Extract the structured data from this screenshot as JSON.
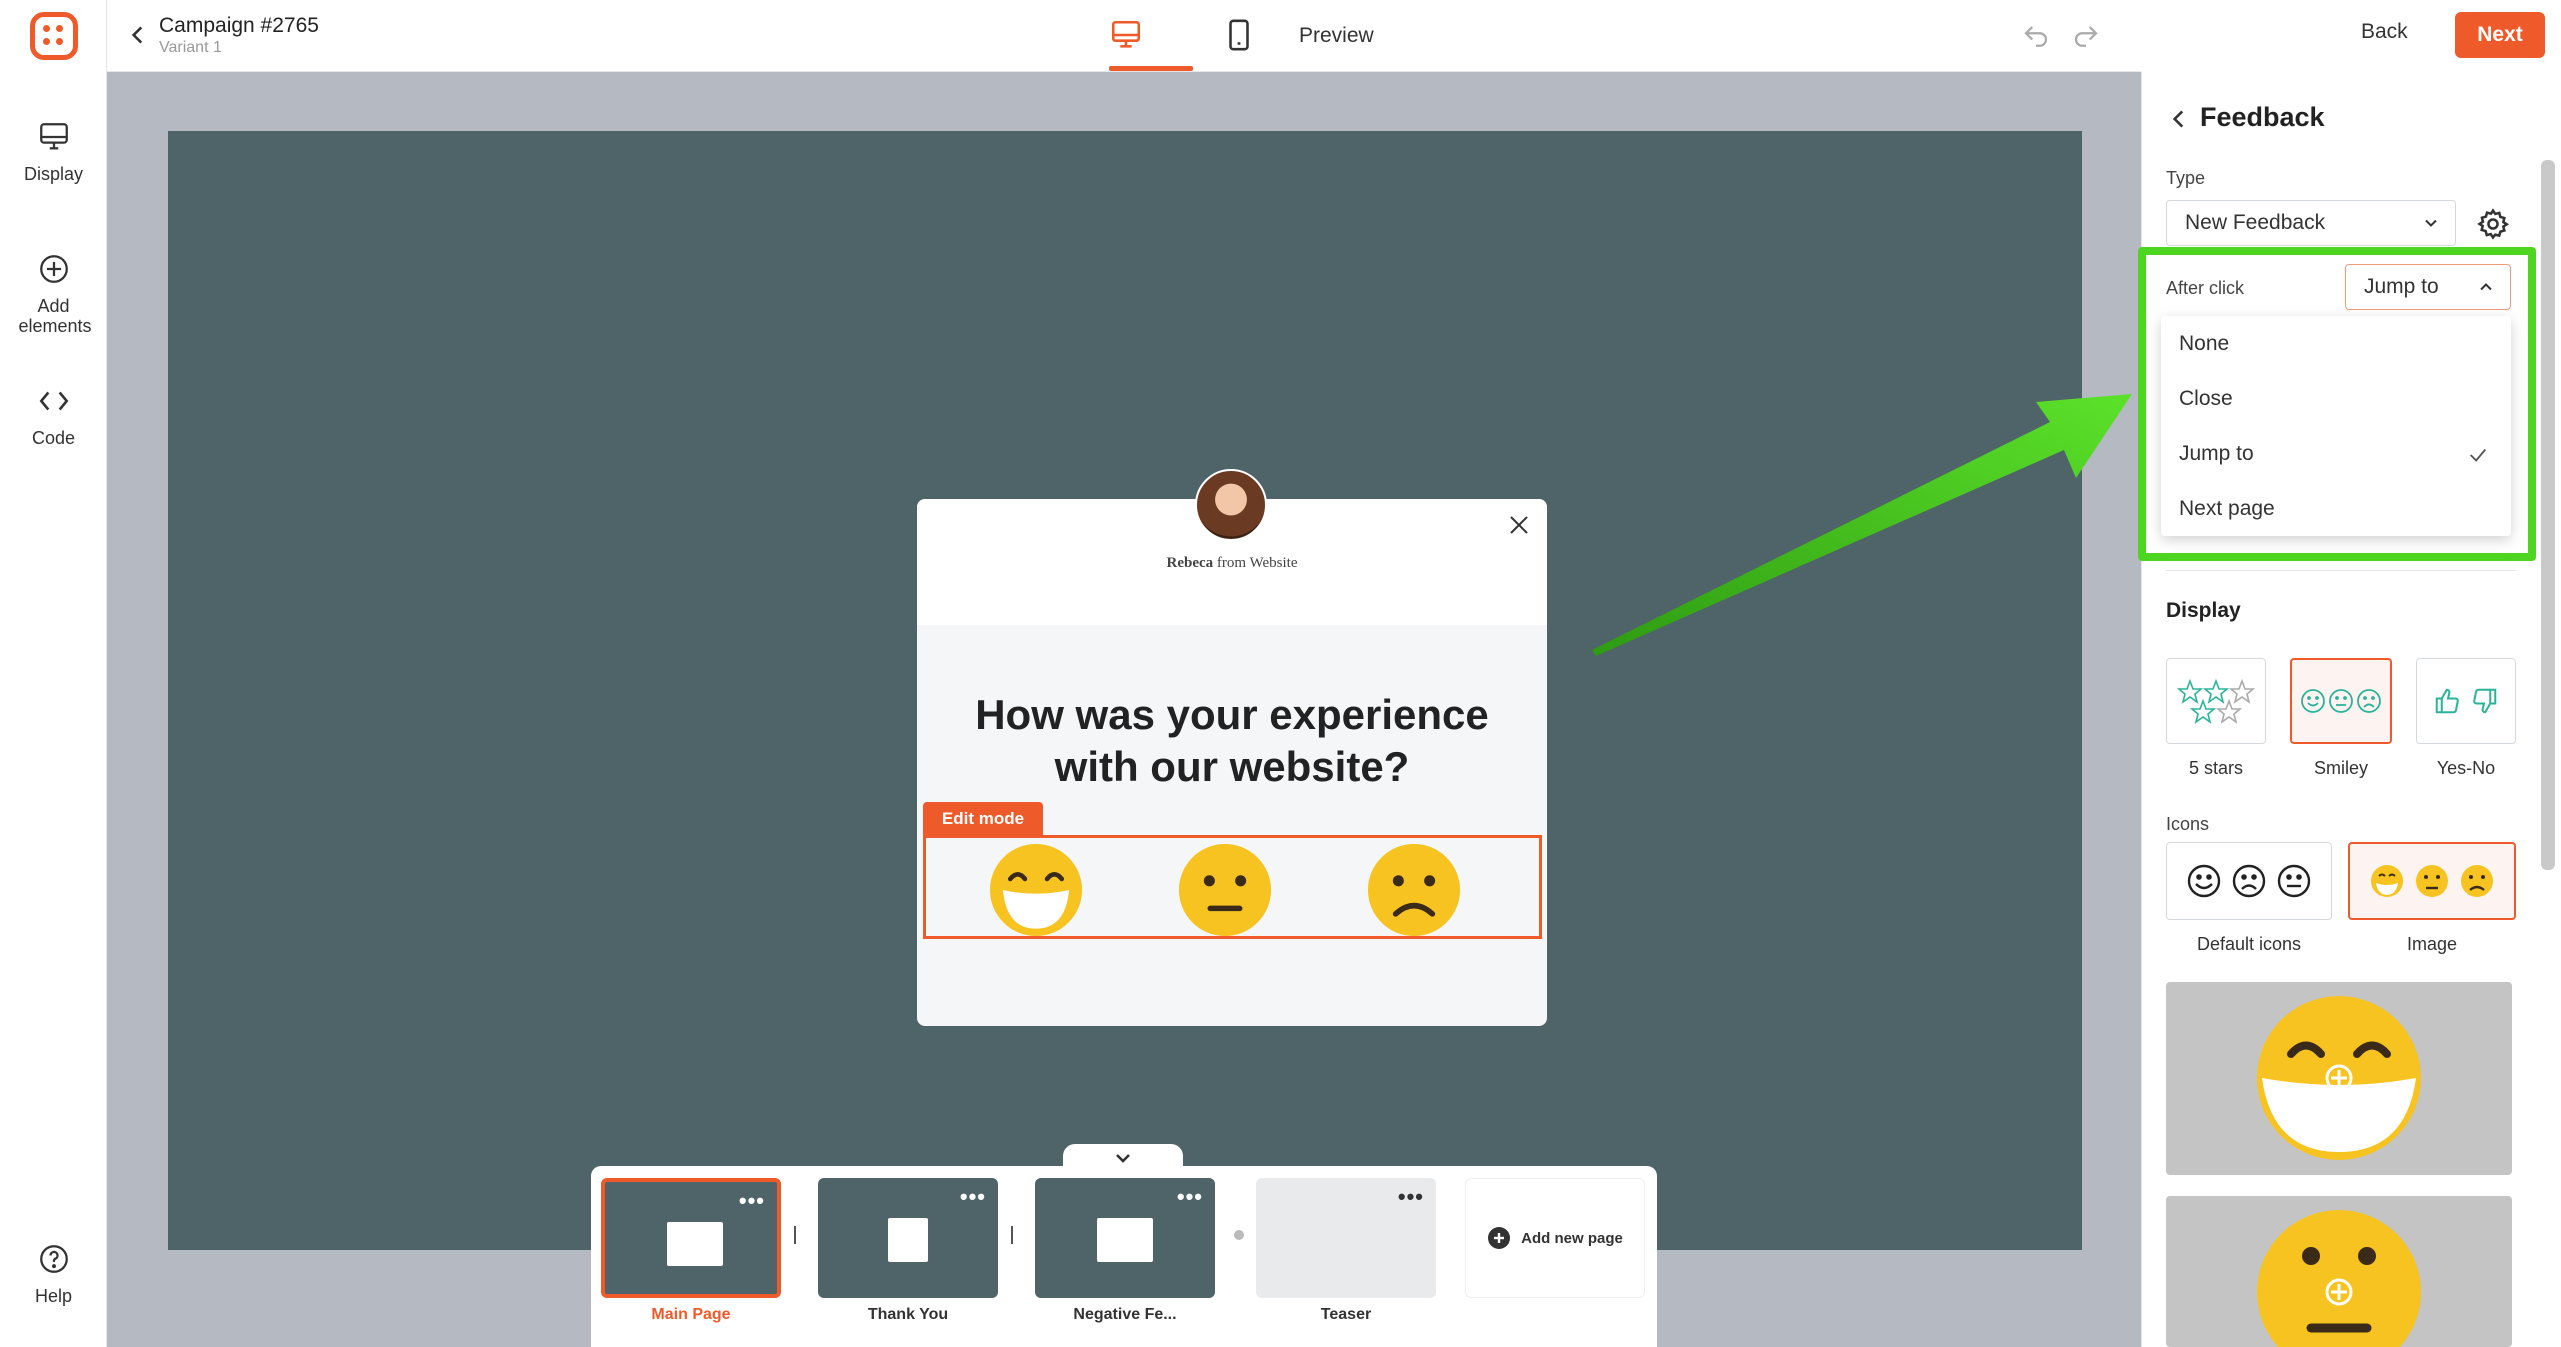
{
  "sidebar": {
    "items": [
      {
        "label": "Display"
      },
      {
        "label": "Add elements"
      },
      {
        "label": "Code"
      },
      {
        "label": "Help"
      }
    ]
  },
  "header": {
    "campaign_title": "Campaign #2765",
    "variant": "Variant 1",
    "preview_label": "Preview",
    "back_label": "Back",
    "next_label": "Next"
  },
  "popup": {
    "author_name": "Rebeca",
    "author_suffix": " from Website",
    "question": "How was your experience with our website?",
    "edit_tag": "Edit mode"
  },
  "pages": [
    {
      "label": "Main Page",
      "active": true
    },
    {
      "label": "Thank You",
      "active": false
    },
    {
      "label": "Negative Fe...",
      "active": false
    },
    {
      "label": "Teaser",
      "active": false
    }
  ],
  "add_page_label": "Add new page",
  "panel": {
    "title": "Feedback",
    "type_label": "Type",
    "type_value": "New Feedback",
    "after_click_label": "After click",
    "after_click_value": "Jump to",
    "dropdown_options": [
      "None",
      "Close",
      "Jump to",
      "Next page"
    ],
    "selected_option": "Jump to",
    "display_title": "Display",
    "display_options": [
      "5 stars",
      "Smiley",
      "Yes-No"
    ],
    "display_selected": "Smiley",
    "icons_label": "Icons",
    "icon_options": [
      "Default icons",
      "Image"
    ],
    "icon_selected": "Image"
  },
  "colors": {
    "accent": "#ee5a29",
    "stage": "#4f6468",
    "highlight": "#4ed51f",
    "emoji": "#f7c320"
  }
}
